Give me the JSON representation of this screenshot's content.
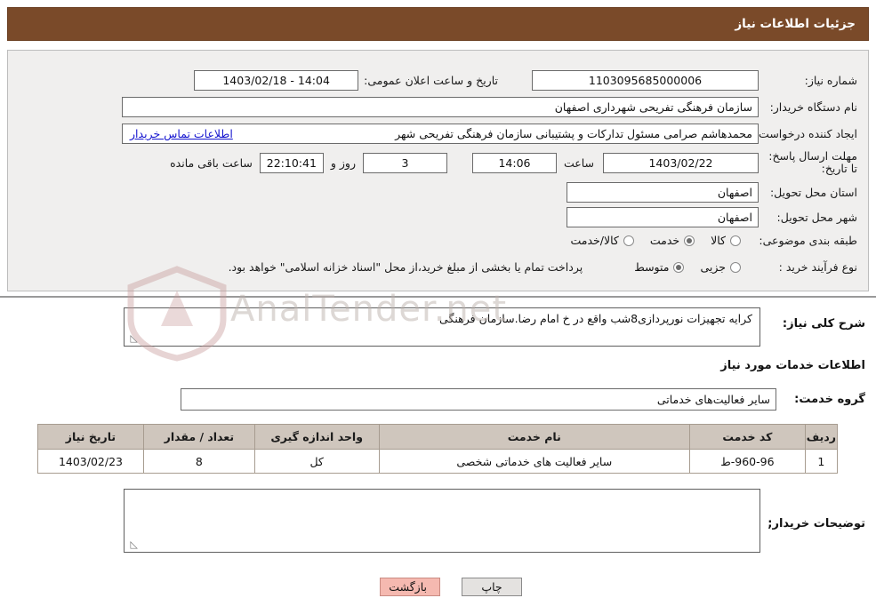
{
  "header": {
    "title": "جزئیات اطلاعات نیاز"
  },
  "form": {
    "need_number_label": "شماره نیاز:",
    "need_number_value": "1103095685000006",
    "public_announce_label": "تاریخ و ساعت اعلان عمومی:",
    "public_announce_value": "14:04 - 1403/02/18",
    "buyer_org_label": "نام دستگاه خریدار:",
    "buyer_org_value": "سازمان فرهنگی تفریحی شهرداری اصفهان",
    "requester_label": "ایجاد کننده درخواست:",
    "requester_value": "محمدهاشم صرامی مسئول تدارکات و پشتیبانی سازمان فرهنگی تفریحی شهر",
    "requester_link": "اطلاعات تماس خریدار",
    "deadline_label": "مهلت ارسال پاسخ: تا تاریخ:",
    "deadline_date": "1403/02/22",
    "deadline_hour_label": "ساعت",
    "deadline_hour": "14:06",
    "remaining_days": "3",
    "remaining_days_label": "روز و",
    "remaining_time": "22:10:41",
    "remaining_time_label": "ساعت باقی مانده",
    "province_label": "استان محل تحویل:",
    "province_value": "اصفهان",
    "city_label": "شهر محل تحویل:",
    "city_value": "اصفهان",
    "category_label": "طبقه بندی موضوعی:",
    "category_options": [
      {
        "label": "کالا",
        "selected": false
      },
      {
        "label": "خدمت",
        "selected": true
      },
      {
        "label": "کالا/خدمت",
        "selected": false
      }
    ],
    "purchase_type_label": "نوع فرآیند خرید :",
    "purchase_type_options": [
      {
        "label": "جزیی",
        "selected": false
      },
      {
        "label": "متوسط",
        "selected": true
      }
    ],
    "purchase_note": "پرداخت تمام یا بخشی از مبلغ خرید،از محل \"اسناد خزانه اسلامی\" خواهد بود."
  },
  "need_summary": {
    "label": "شرح کلی نیاز:",
    "value": "کرایه تجهیزات نورپردازی8شب واقع در خ امام رضا.سازمان فرهنگی"
  },
  "services_section": {
    "title": "اطلاعات خدمات مورد نیاز",
    "group_label": "گروه خدمت:",
    "group_value": "سایر فعالیت‌های خدماتی"
  },
  "table": {
    "columns": [
      "ردیف",
      "کد خدمت",
      "نام خدمت",
      "واحد اندازه گیری",
      "تعداد / مقدار",
      "تاریخ نیاز"
    ],
    "rows": [
      {
        "radif": "1",
        "code": "960-96-ط",
        "name": "سایر فعالیت های خدماتی شخصی",
        "unit": "کل",
        "qty": "8",
        "date": "1403/02/23"
      }
    ]
  },
  "buyer_notes": {
    "label": "توضیحات خریدار;",
    "value": ""
  },
  "buttons": {
    "print": "چاپ",
    "back": "بازگشت"
  },
  "watermark": {
    "text": "AnalTender.net"
  }
}
